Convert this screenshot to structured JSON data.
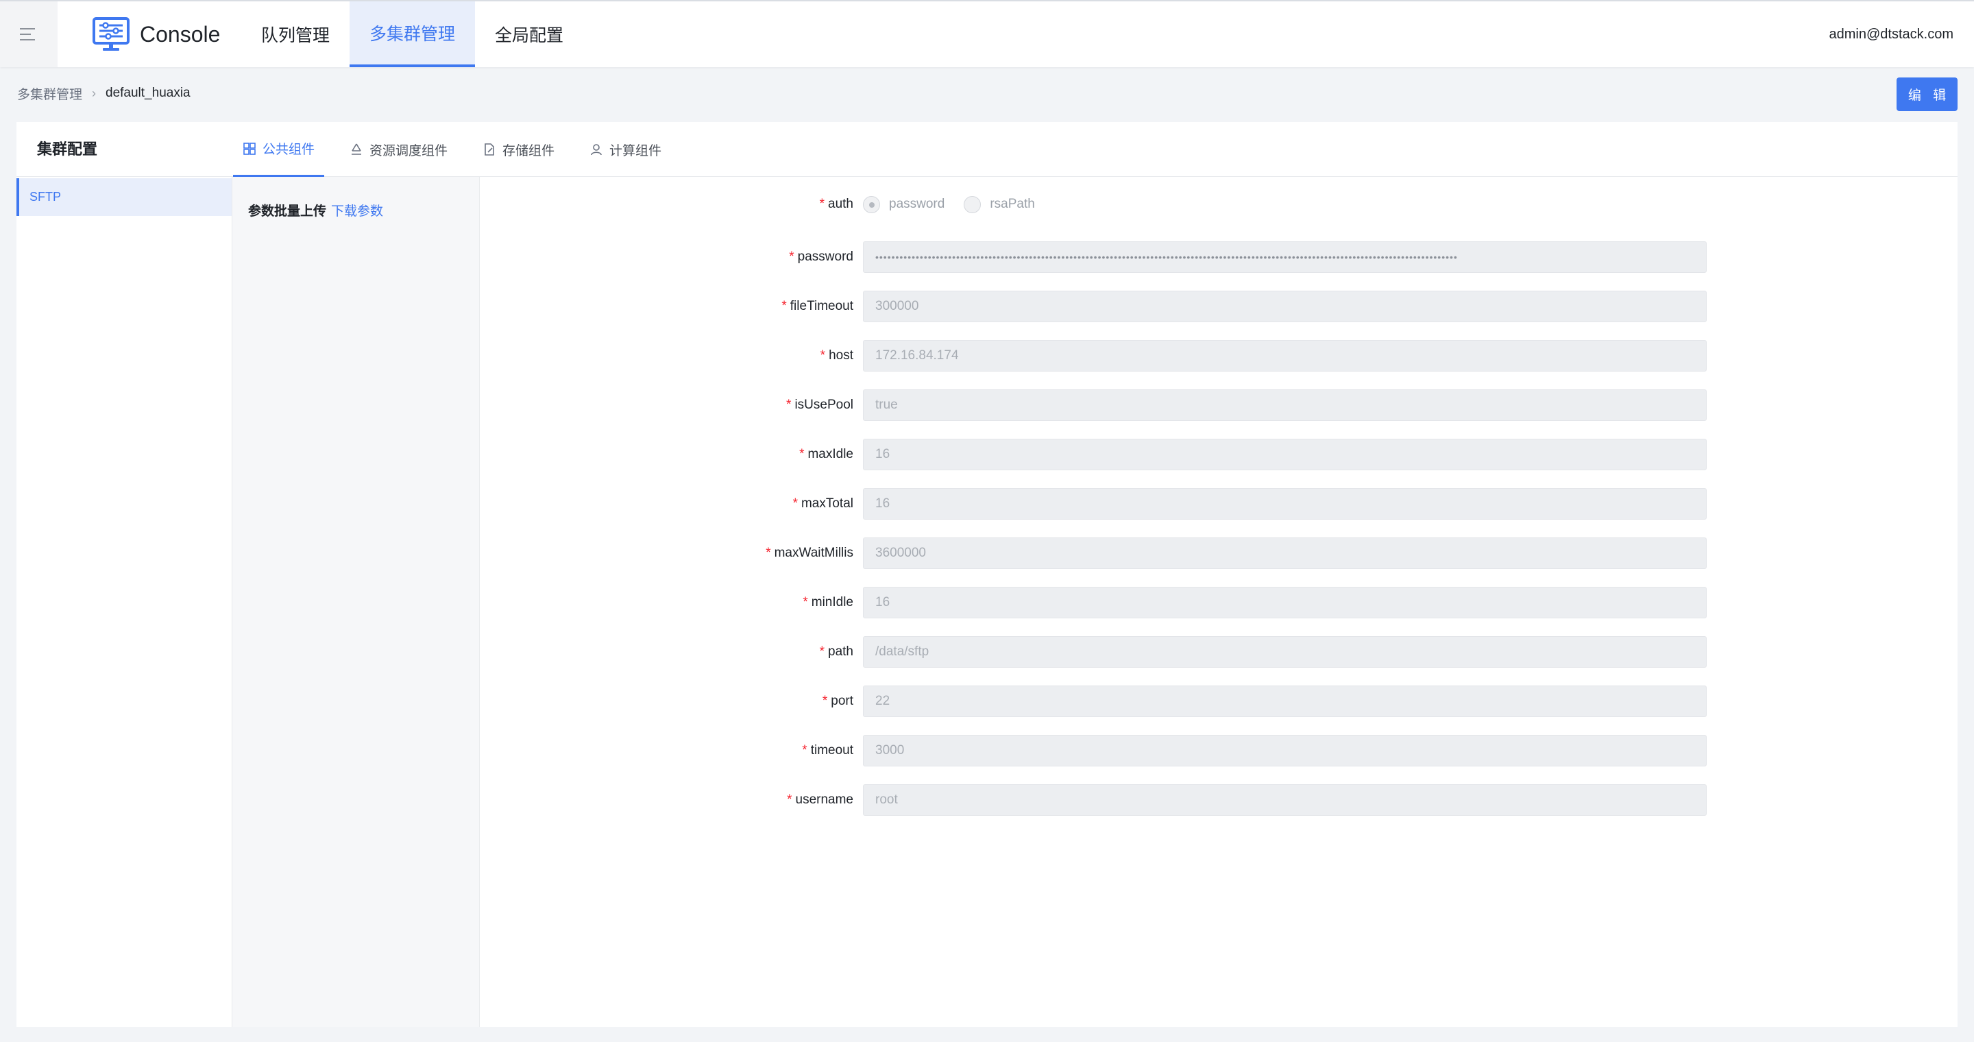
{
  "app": {
    "title": "Console"
  },
  "nav": {
    "items": [
      "队列管理",
      "多集群管理",
      "全局配置"
    ],
    "active": "多集群管理"
  },
  "user": {
    "email": "admin@dtstack.com"
  },
  "breadcrumb": {
    "parent": "多集群管理",
    "current": "default_huaxia"
  },
  "actions": {
    "edit_label": "编 辑"
  },
  "sidebar": {
    "title": "集群配置",
    "items": [
      {
        "label": "SFTP"
      }
    ]
  },
  "tabs": [
    {
      "label": "公共组件",
      "icon": "grid-icon",
      "active": true
    },
    {
      "label": "资源调度组件",
      "icon": "recycle-icon",
      "active": false
    },
    {
      "label": "存储组件",
      "icon": "file-edit-icon",
      "active": false
    },
    {
      "label": "计算组件",
      "icon": "user-icon",
      "active": false
    }
  ],
  "upload": {
    "label": "参数批量上传",
    "link": "下载参数"
  },
  "form": {
    "auth": {
      "label": "auth",
      "options": [
        "password",
        "rsaPath"
      ],
      "selected": "password"
    },
    "fields": [
      {
        "label": "password",
        "value": "••••••••••••••••••••••••••••••••••••••••••••••••••••••••••••••••••••••••••••••••••••••••••••••••••••••••••••••••••••••••••••••••••••••••••••••••"
      },
      {
        "label": "fileTimeout",
        "value": "300000"
      },
      {
        "label": "host",
        "value": "172.16.84.174"
      },
      {
        "label": "isUsePool",
        "value": "true"
      },
      {
        "label": "maxIdle",
        "value": "16"
      },
      {
        "label": "maxTotal",
        "value": "16"
      },
      {
        "label": "maxWaitMillis",
        "value": "3600000"
      },
      {
        "label": "minIdle",
        "value": "16"
      },
      {
        "label": "path",
        "value": "/data/sftp"
      },
      {
        "label": "port",
        "value": "22"
      },
      {
        "label": "timeout",
        "value": "3000"
      },
      {
        "label": "username",
        "value": "root"
      }
    ]
  },
  "colors": {
    "accent": "#3f78f0",
    "required": "#f5222d",
    "input_bg": "#eceef1"
  }
}
